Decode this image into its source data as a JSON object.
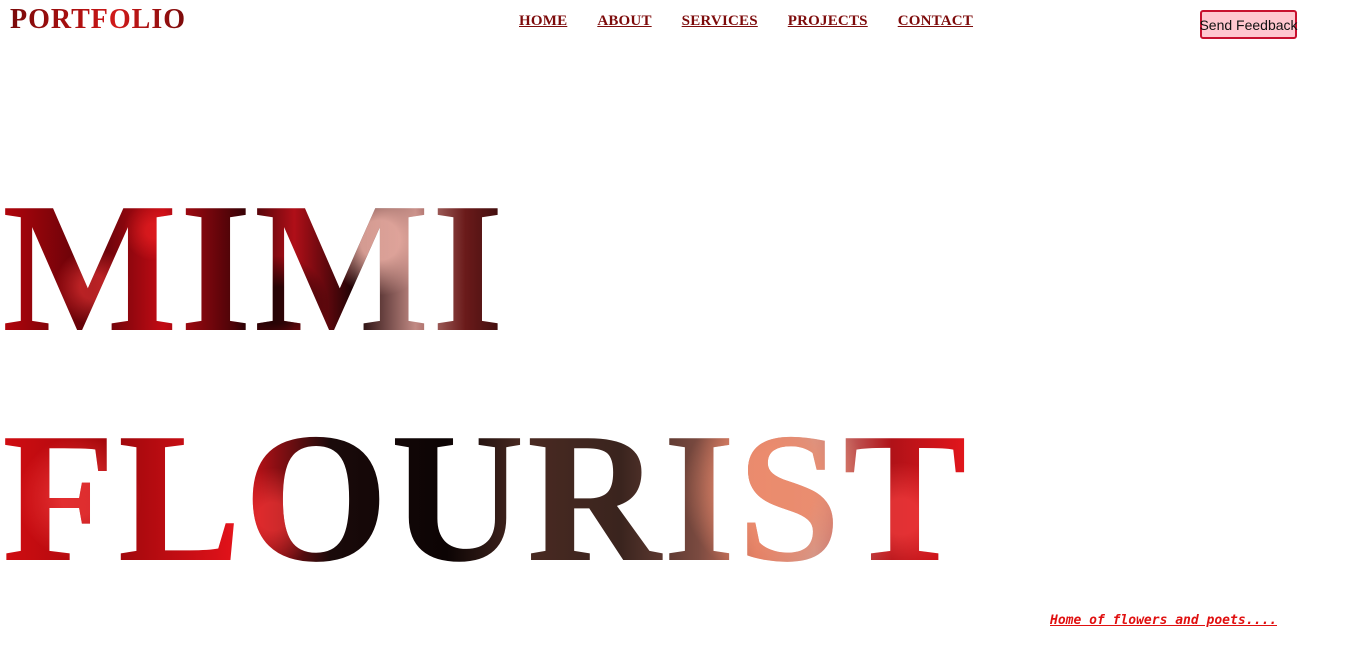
{
  "header": {
    "logo": "PORTFOLIO",
    "nav": [
      {
        "label": "HOME"
      },
      {
        "label": "ABOUT"
      },
      {
        "label": "SERVICES"
      },
      {
        "label": "PROJECTS"
      },
      {
        "label": "CONTACT"
      }
    ],
    "feedback_button": "Send Feedback"
  },
  "hero": {
    "line1": "MIMI",
    "line2": "FLOURIST"
  },
  "tagline": "Home of flowers and poets....",
  "colors": {
    "brand": "#8b0d0d",
    "nav_text": "#7d0b0b",
    "button_bg": "#ffc7cf",
    "button_border": "#c8102e",
    "tagline": "#e01010"
  }
}
